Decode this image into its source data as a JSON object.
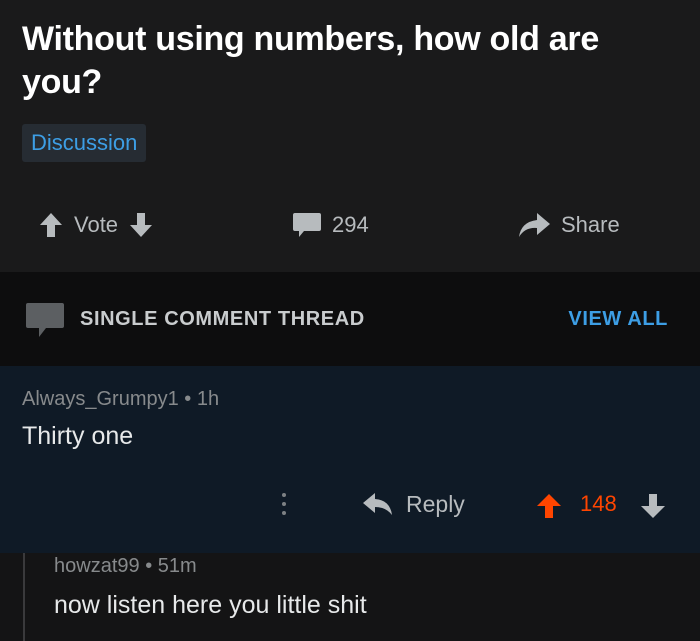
{
  "post": {
    "title": "Without using numbers, how old are you?",
    "flair": "Discussion",
    "vote_label": "Vote",
    "comment_count": "294",
    "share_label": "Share"
  },
  "thread": {
    "label": "SINGLE COMMENT THREAD",
    "view_all": "VIEW ALL"
  },
  "comment": {
    "author": "Always_Grumpy1",
    "age": "1h",
    "body": "Thirty one",
    "reply_label": "Reply",
    "score": "148",
    "score_color": "#ff4500"
  },
  "reply": {
    "author": "howzat99",
    "age": "51m",
    "body": "now listen here you little shit"
  },
  "colors": {
    "accent": "#3d9ee5",
    "upvote": "#ff4500"
  },
  "icons": [
    "arrow-up-icon",
    "arrow-down-icon",
    "comment-bubble-icon",
    "share-arrow-icon",
    "reply-arrow-icon",
    "more-options-icon"
  ]
}
